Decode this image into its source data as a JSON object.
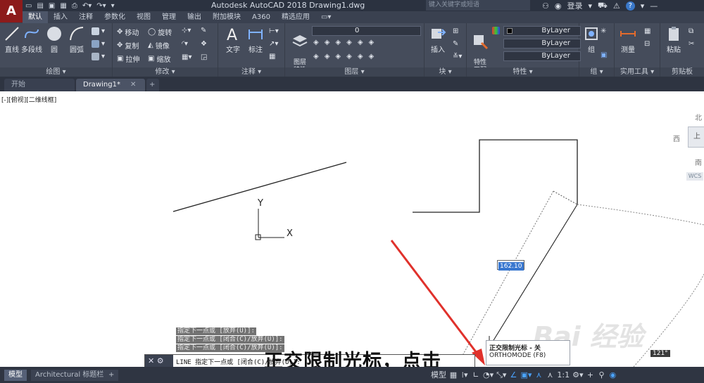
{
  "titlebar": {
    "logo": "A",
    "doc_title": "Autodesk AutoCAD 2018    Drawing1.dwg",
    "search_placeholder": "键入关键字或短语",
    "login": "登录"
  },
  "ribbon_tabs": [
    "默认",
    "插入",
    "注释",
    "参数化",
    "视图",
    "管理",
    "输出",
    "附加模块",
    "A360",
    "精选应用",
    "▭▾"
  ],
  "panels": {
    "draw": {
      "title": "绘图 ▾",
      "buttons": [
        "直线",
        "多段线",
        "圆",
        "圆弧"
      ]
    },
    "modify": {
      "title": "修改 ▾",
      "rows": [
        "移动",
        "旋转",
        "复制",
        "镜像",
        "拉伸",
        "缩放"
      ]
    },
    "annotation": {
      "title": "注释 ▾",
      "buttons": [
        "文字",
        "标注"
      ]
    },
    "layers": {
      "title": "图层 ▾",
      "button": "图层\n特性",
      "layer_value": "0"
    },
    "block": {
      "title": "块 ▾",
      "button": "插入"
    },
    "properties": {
      "title": "特性 ▾",
      "button": "特性\n匹配",
      "combos": [
        "ByLayer",
        "ByLayer",
        "ByLayer"
      ]
    },
    "groups": {
      "title": "组 ▾",
      "button": "组"
    },
    "utilities": {
      "title": "实用工具 ▾",
      "button": "测量"
    },
    "clipboard": {
      "title": "剪贴板",
      "button": "粘贴"
    }
  },
  "doc_tabs": [
    "开始",
    "Drawing1*"
  ],
  "canvas": {
    "viewport_label": "[-][俯视][二维线框]",
    "ucs_x": "X",
    "ucs_y": "Y",
    "dim_value": "162.10",
    "tooltip_title": "正交限制光标 - 关",
    "tooltip_sub": "ORTHOMODE (F8)",
    "angle_value": "121°",
    "viewcube": {
      "north": "北",
      "west": "西",
      "top": "上",
      "south": "南",
      "wcs": "WCS"
    },
    "cmd_history": [
      "指定下一点或 [放弃(U)]:",
      "指定下一点或 [闭合(C)/放弃(U)]:",
      "指定下一点或 [闭合(C)/放弃(U)]:"
    ],
    "cmd_line": "LINE 指定下一点或 [闭合(C)/放弃(U)]:",
    "caption": "正交限制光标，点击",
    "watermark": "Bai 经验"
  },
  "statusbar": {
    "layout_tabs": [
      "模型",
      "Architectural 标题栏",
      "+"
    ],
    "model_label": "模型",
    "scale": "1:1"
  },
  "colors": {
    "title_bg": "#2b3240",
    "ribbon_bg": "#454c5b",
    "accent_blue": "#3a78d0",
    "arrow_red": "#e0312b"
  }
}
